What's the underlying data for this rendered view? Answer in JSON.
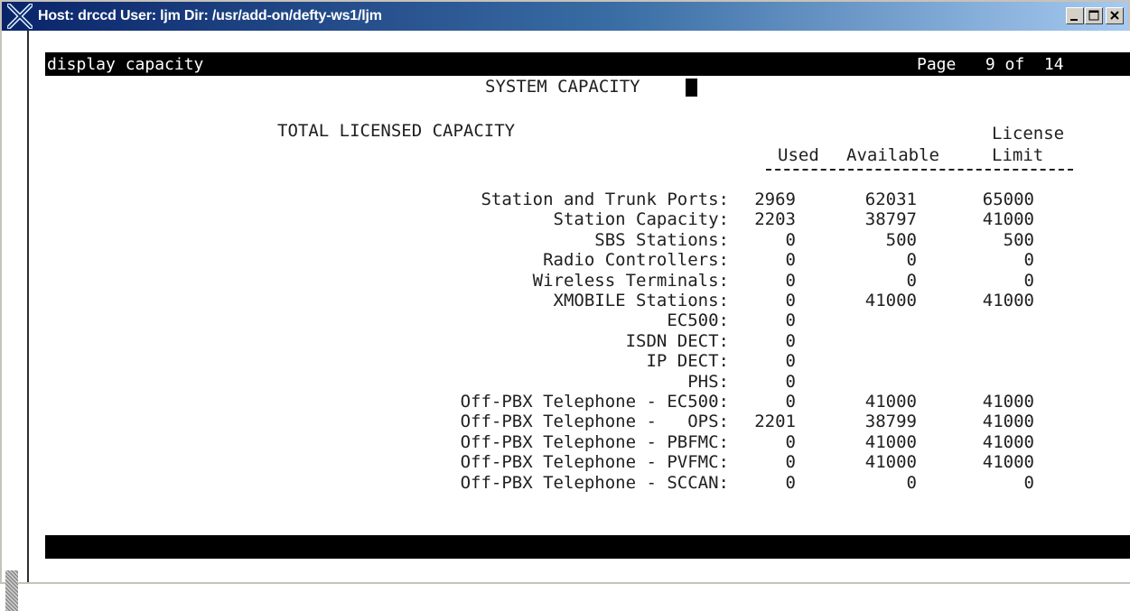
{
  "window": {
    "title": "Host: drccd  User: ljm   Dir: /usr/add-on/defty-ws1/ljm"
  },
  "terminal": {
    "command": "display capacity",
    "page_indicator": "Page   9 of  14",
    "screen_title": "SYSTEM CAPACITY",
    "section_title": "TOTAL LICENSED CAPACITY",
    "columns": {
      "used": "Used",
      "available": "Available",
      "license_line1": "License",
      "license_line2": "Limit"
    },
    "rows": [
      {
        "label": "Station and Trunk Ports:",
        "used": "2969",
        "available": "62031",
        "limit": "65000"
      },
      {
        "label": "Station Capacity:",
        "used": "2203",
        "available": "38797",
        "limit": "41000"
      },
      {
        "label": "SBS Stations:",
        "used": "0",
        "available": "500",
        "limit": "500"
      },
      {
        "label": "Radio Controllers:",
        "used": "0",
        "available": "0",
        "limit": "0"
      },
      {
        "label": "Wireless Terminals:",
        "used": "0",
        "available": "0",
        "limit": "0"
      },
      {
        "label": "XMOBILE Stations:",
        "used": "0",
        "available": "41000",
        "limit": "41000"
      },
      {
        "label": "EC500:",
        "used": "0",
        "available": "",
        "limit": ""
      },
      {
        "label": "ISDN DECT:",
        "used": "0",
        "available": "",
        "limit": ""
      },
      {
        "label": "IP DECT:",
        "used": "0",
        "available": "",
        "limit": ""
      },
      {
        "label": "PHS:",
        "used": "0",
        "available": "",
        "limit": ""
      },
      {
        "label": "Off-PBX Telephone - EC500:",
        "used": "0",
        "available": "41000",
        "limit": "41000"
      },
      {
        "label": "Off-PBX Telephone -   OPS:",
        "used": "2201",
        "available": "38799",
        "limit": "41000"
      },
      {
        "label": "Off-PBX Telephone - PBFMC:",
        "used": "0",
        "available": "41000",
        "limit": "41000"
      },
      {
        "label": "Off-PBX Telephone - PVFMC:",
        "used": "0",
        "available": "41000",
        "limit": "41000"
      },
      {
        "label": "Off-PBX Telephone - SCCAN:",
        "used": "0",
        "available": "0",
        "limit": "0"
      }
    ]
  },
  "icons": {
    "app": "x-terminal-icon",
    "minimize": "minimize-icon",
    "maximize": "maximize-icon",
    "close": "close-icon"
  }
}
